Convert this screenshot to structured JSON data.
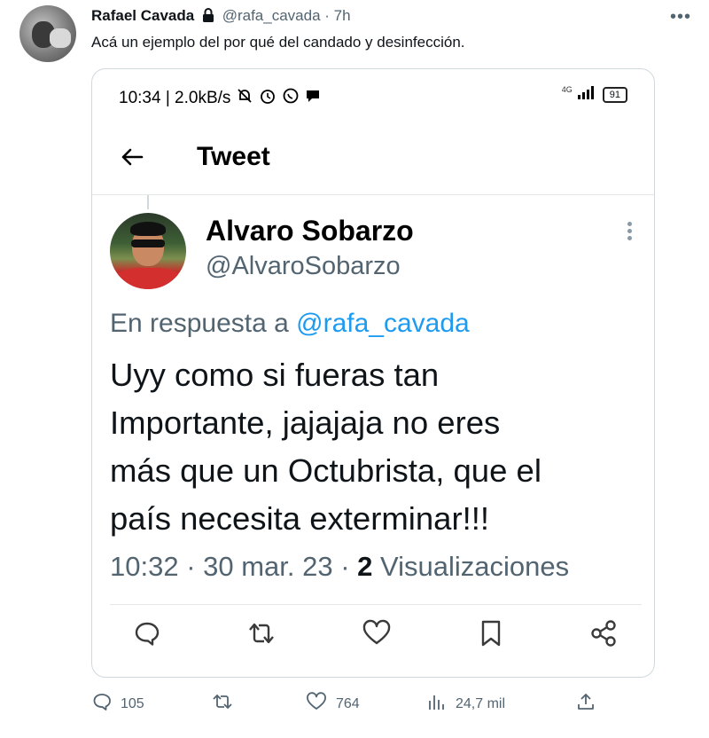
{
  "post": {
    "author_name": "Rafael Cavada",
    "handle": "@rafa_cavada",
    "separator": "·",
    "time": "7h",
    "text": "Acá  un ejemplo del por qué del candado y desinfección."
  },
  "screenshot": {
    "status_bar": {
      "time": "10:34 | 2.0kB/s",
      "network": "4G",
      "battery": "91"
    },
    "nav_title": "Tweet",
    "quoted": {
      "name": "Alvaro Sobarzo",
      "handle": "@AlvaroSobarzo",
      "reply_prefix": "En respuesta a",
      "reply_handle": "@rafa_cavada",
      "body_lines": [
        "Uyy como si fueras tan",
        "Importante, jajajaja no eres",
        "más que un Octubrista, que el",
        "país necesita exterminar!!!"
      ],
      "meta_time": "10:32 · 30 mar. 23 · ",
      "views_count": "2",
      "views_label": " Visualizaciones"
    }
  },
  "actions": {
    "replies": "105",
    "likes": "764",
    "views": "24,7 mil"
  },
  "colors": {
    "link": "#1d9bf0",
    "muted": "#536471",
    "text": "#0f1419",
    "border": "#cfd9de"
  }
}
